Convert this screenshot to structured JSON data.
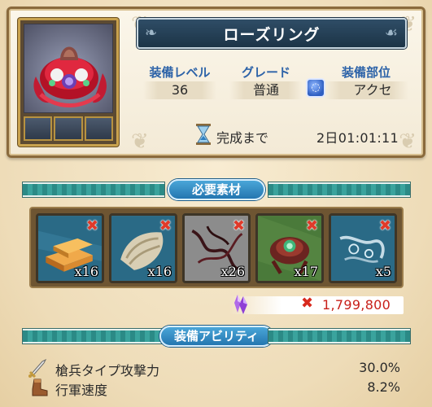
{
  "item": {
    "name": "ローズリング",
    "image_icon": "rose-ring-icon",
    "slot_icons": [
      "empty-slot-icon",
      "empty-slot-icon",
      "empty-slot-icon"
    ]
  },
  "stats": {
    "level_label": "装備レベル",
    "level_value": "36",
    "grade_label": "グレード",
    "grade_value": "普通",
    "slot_label": "装備部位",
    "slot_value": "アクセ",
    "slot_icon": "accessory-ring-icon"
  },
  "timer": {
    "icon": "hourglass-icon",
    "label": "完成まで",
    "value": "2日01:01:11"
  },
  "materials_section": {
    "title": "必要素材",
    "items": [
      {
        "icon": "gold-bars-icon",
        "quantity": "x16",
        "missing_icon": "red-x-icon"
      },
      {
        "icon": "cloth-bundle-icon",
        "quantity": "x16",
        "missing_icon": "red-x-icon"
      },
      {
        "icon": "dark-vines-icon",
        "quantity": "x26",
        "missing_icon": "red-x-icon"
      },
      {
        "icon": "gem-bracelet-icon",
        "quantity": "x17",
        "missing_icon": "red-x-icon"
      },
      {
        "icon": "frost-chain-icon",
        "quantity": "x5",
        "missing_icon": "red-x-icon"
      }
    ]
  },
  "cost": {
    "icon": "purple-crystal-icon",
    "x_mark": "✖",
    "value": "1,799,800"
  },
  "abilities_section": {
    "title": "装備アビリティ",
    "rows": [
      {
        "icon": "sword-icon",
        "name": "槍兵タイプ攻撃力",
        "value": "30.0%"
      },
      {
        "icon": "boot-icon",
        "name": "行軍速度",
        "value": "8.2%"
      }
    ]
  },
  "colors": {
    "accent_blue": "#2d63a8",
    "title_banner": "#1c3447",
    "teal_band": "#2b8a86",
    "cost_red": "#c8201a"
  }
}
